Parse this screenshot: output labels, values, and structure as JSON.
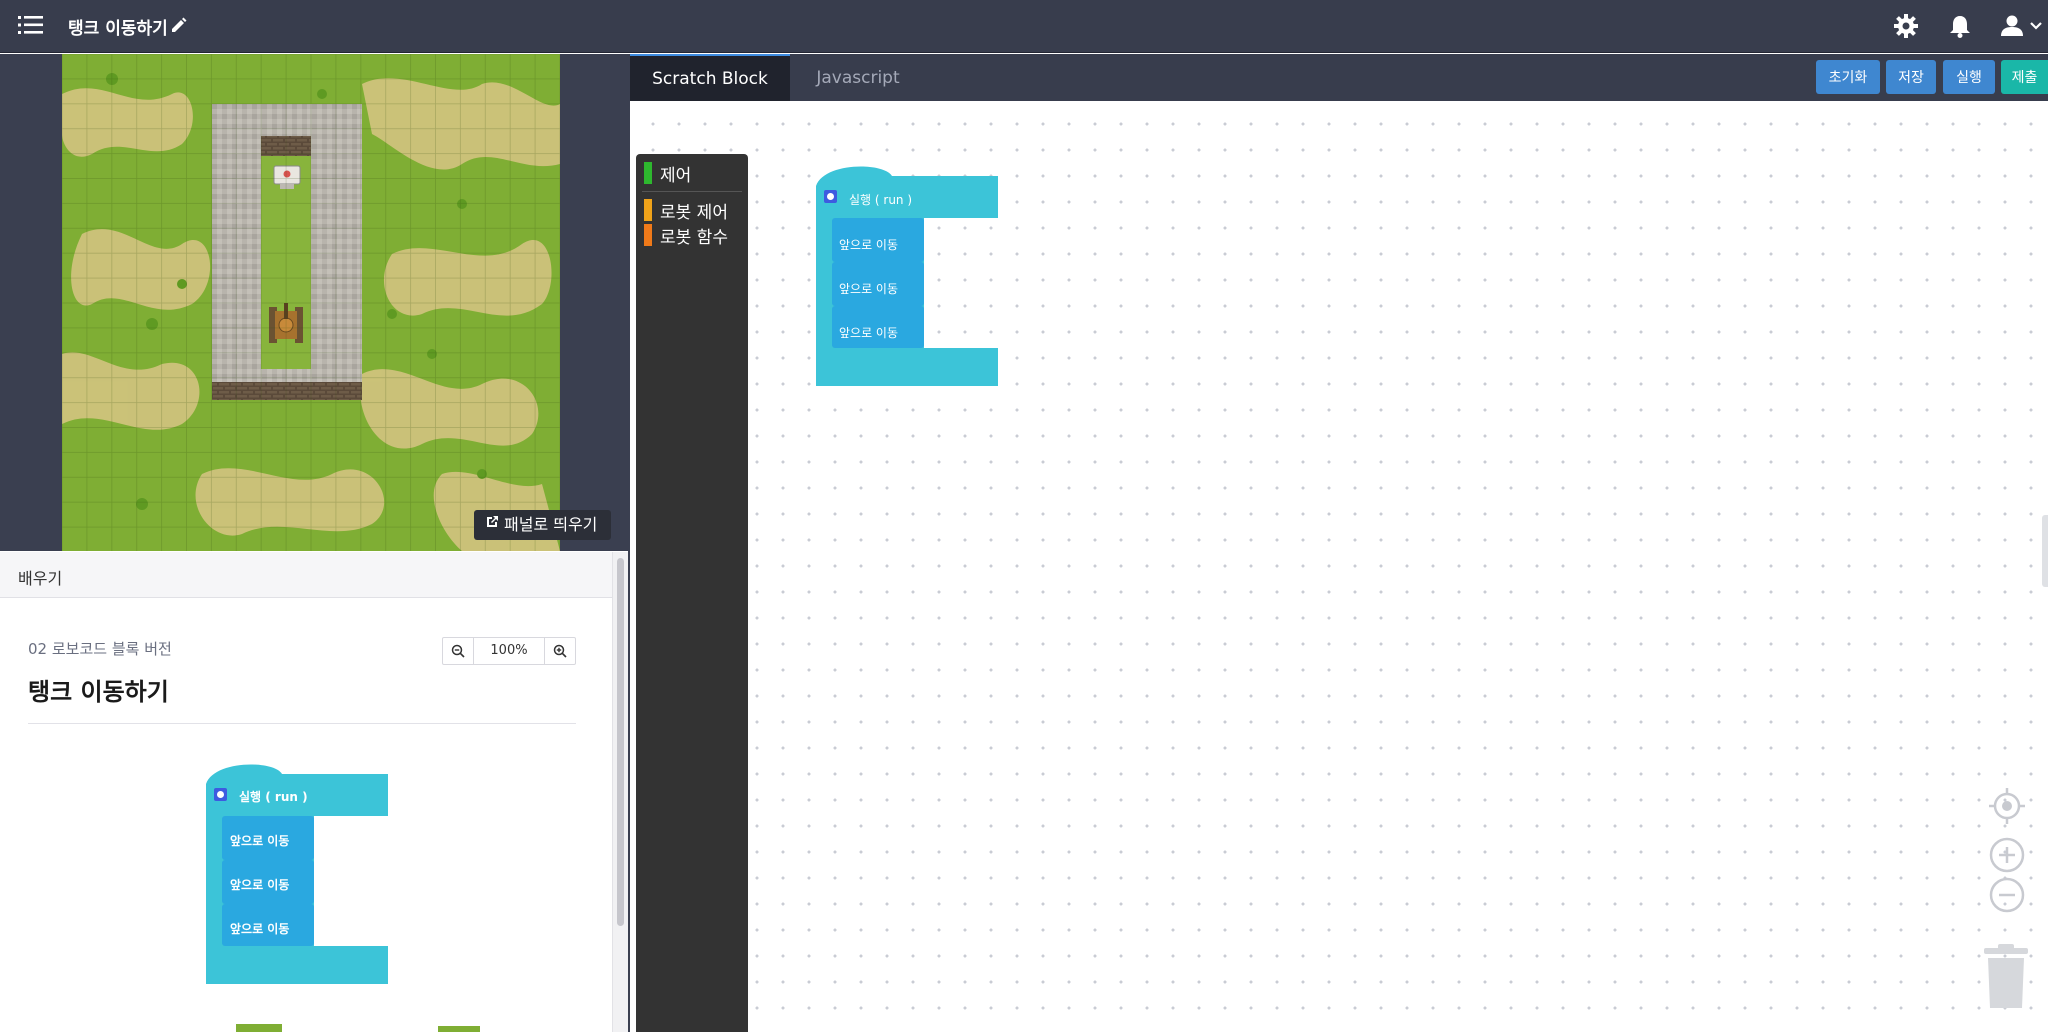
{
  "header": {
    "title": "탱크 이동하기"
  },
  "game": {
    "popout_label": "패널로 띄우기"
  },
  "learn": {
    "tab_label": "배우기",
    "lesson_subtitle": "02 로보코드 블록 버전",
    "lesson_title": "탱크 이동하기",
    "zoom_value": "100%"
  },
  "tabs": {
    "active": "Scratch Block",
    "inactive": "Javascript"
  },
  "actions": {
    "reset": "초기화",
    "save": "저장",
    "run": "실행",
    "submit": "제출"
  },
  "toolbox": {
    "categories": [
      {
        "label": "제어",
        "color": "#2eb82e"
      },
      {
        "label": "로봇 제어",
        "color": "#f0a319"
      },
      {
        "label": "로봇 함수",
        "color": "#f07a19"
      }
    ]
  },
  "workspace_blocks": {
    "hat_label": "실행 (   run   )",
    "move_labels": [
      "앞으로 이동",
      "앞으로 이동",
      "앞으로 이동"
    ]
  },
  "lesson_blocks": {
    "hat_label": "실행 (   run   )",
    "move_labels": [
      "앞으로 이동",
      "앞으로 이동",
      "앞으로 이동"
    ]
  },
  "colors": {
    "topbar": "#383d4d",
    "hat_block": "#3cc4d8",
    "move_block": "#2aa8e0",
    "reset_btn": "#3f87d0",
    "submit_btn": "#1ab7a8"
  }
}
